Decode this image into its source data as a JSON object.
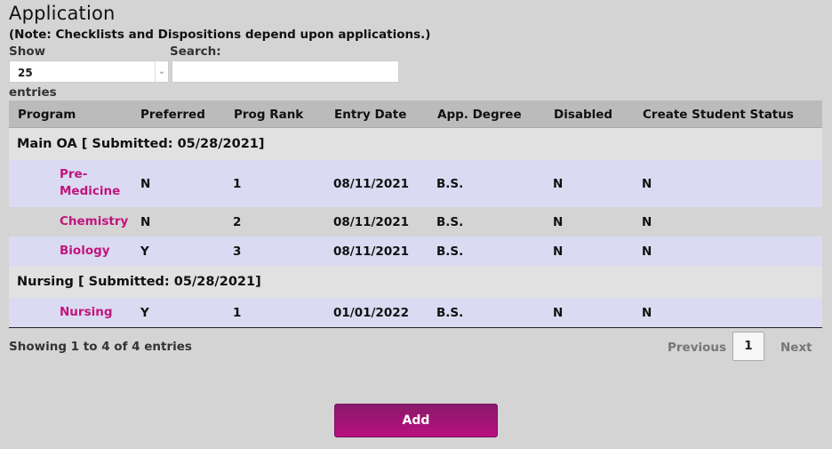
{
  "page": {
    "title": "Application",
    "note": "(Note: Checklists and Dispositions depend upon applications.)"
  },
  "controls": {
    "show_label": "Show",
    "show_value": "25",
    "entries_label": "entries",
    "search_label": "Search:",
    "search_value": ""
  },
  "table": {
    "headers": [
      "Program",
      "Preferred",
      "Prog Rank",
      "Entry Date",
      "App. Degree",
      "Disabled",
      "Create Student Status"
    ],
    "groups": [
      {
        "title": "Main OA [ Submitted: 05/28/2021]",
        "rows": [
          {
            "program_line1": "Pre-",
            "program_line2": "Medicine",
            "preferred": "N",
            "rank": "1",
            "entry_date": "08/11/2021",
            "degree": "B.S.",
            "disabled": "N",
            "create_status": "N"
          },
          {
            "program": "Chemistry",
            "preferred": "N",
            "rank": "2",
            "entry_date": "08/11/2021",
            "degree": "B.S.",
            "disabled": "N",
            "create_status": "N"
          },
          {
            "program": "Biology",
            "preferred": "Y",
            "rank": "3",
            "entry_date": "08/11/2021",
            "degree": "B.S.",
            "disabled": "N",
            "create_status": "N"
          }
        ]
      },
      {
        "title": "Nursing [ Submitted: 05/28/2021]",
        "rows": [
          {
            "program": "Nursing",
            "preferred": "Y",
            "rank": "1",
            "entry_date": "01/01/2022",
            "degree": "B.S.",
            "disabled": "N",
            "create_status": "N"
          }
        ]
      }
    ]
  },
  "footer": {
    "info": "Showing 1 to 4 of 4 entries",
    "previous": "Previous",
    "current_page": "1",
    "next": "Next"
  },
  "actions": {
    "add_label": "Add"
  },
  "colors": {
    "accent": "#c0157d",
    "row_highlight": "#dadaf2",
    "background": "#d4d4d4"
  }
}
